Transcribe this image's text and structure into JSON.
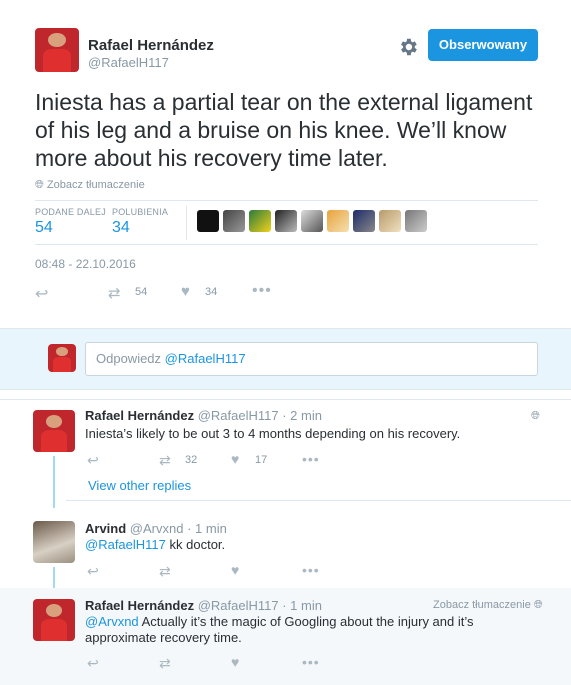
{
  "main_tweet": {
    "author_name": "Rafael Hernández",
    "author_handle": "@RafaelH117",
    "follow_label": "Obserwowany",
    "text": "Iniesta has a partial tear on the external ligament of his leg and a bruise on his knee. We’ll know more about his recovery time later.",
    "translate_label": "Zobacz tłumaczenie",
    "retweets_label": "PODANE DALEJ",
    "retweets_count": "54",
    "likes_label": "POLUBIENIA",
    "likes_count": "34",
    "timestamp": "08:48 - 22.10.2016",
    "action_retweet_count": "54",
    "action_like_count": "34"
  },
  "reply_box": {
    "placeholder_prefix": "Odpowiedz",
    "mention": "@RafaelH117"
  },
  "replies": [
    {
      "author_name": "Rafael Hernández",
      "author_handle": "@RafaelH117",
      "time": "· 2 min",
      "text": "Iniesta’s likely to be out 3 to 4 months depending on his recovery.",
      "retweet_count": "32",
      "like_count": "17"
    },
    {
      "view_other": "View other replies"
    },
    {
      "author_name": "Arvind",
      "author_handle": "@Arvxnd",
      "time": "· 1 min",
      "mention": "@RafaelH117",
      "text": "kk doctor."
    },
    {
      "author_name": "Rafael Hernández",
      "author_handle": "@RafaelH117",
      "time": "· 1 min",
      "translate_label": "Zobacz tłumaczenie",
      "mention": "@Arvxnd",
      "text_line1": "Actually it’s the magic of Googling about the injury and it’s",
      "text_line2": "approximate recovery time."
    }
  ],
  "colors": {
    "accent": "#1b95e0",
    "muted": "#8899a6",
    "thread": "#a5d8f3"
  }
}
